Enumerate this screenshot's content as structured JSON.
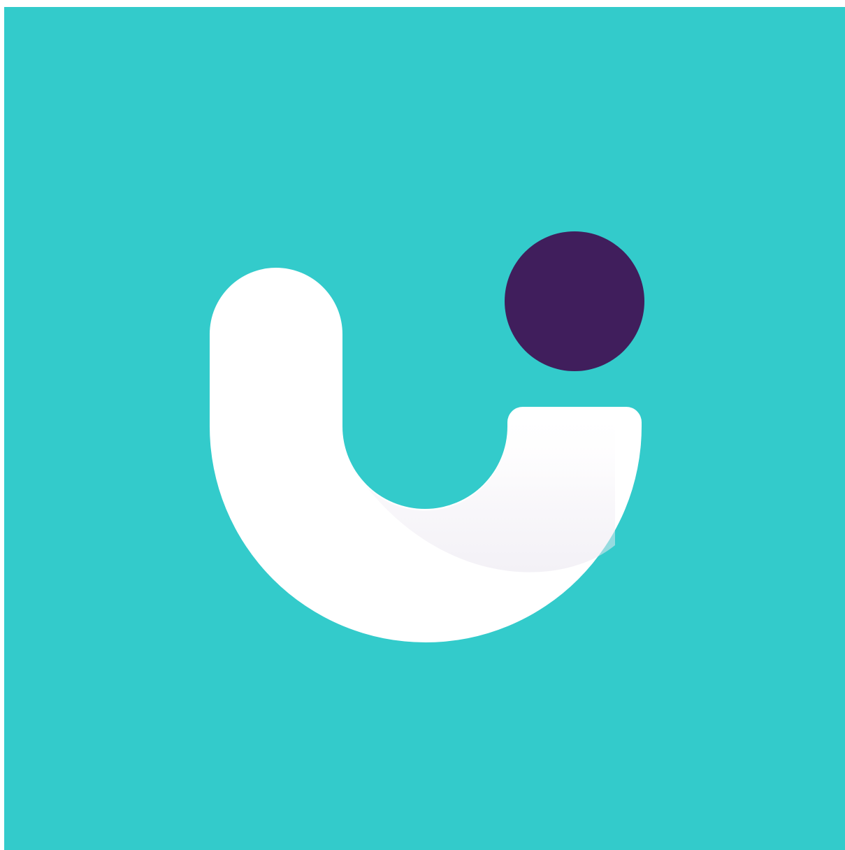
{
  "logo": {
    "mark": "u-with-dot-logo",
    "colors": {
      "background": "#33CBCB",
      "shape": "#FFFFFF",
      "shadow": "#EDEAF2",
      "dot": "#401E5C",
      "page": "#FFFFFF"
    }
  }
}
